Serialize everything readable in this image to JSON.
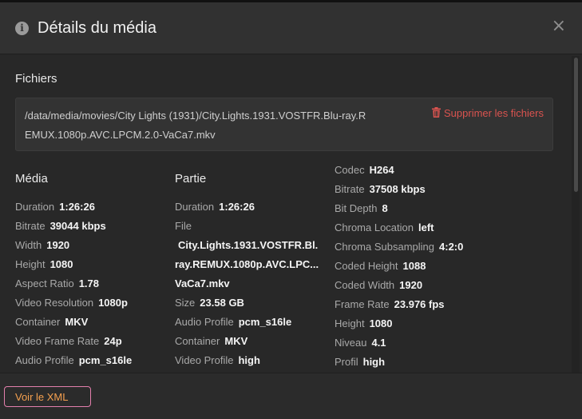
{
  "header": {
    "title": "Détails du média",
    "info_icon": "i",
    "close_icon": "×"
  },
  "files": {
    "section_title": "Fichiers",
    "path": "/data/media/movies/City Lights (1931)/City.Lights.1931.VOSTFR.Blu-ray.REMUX.1080p.AVC.LPCM.2.0-VaCa7.mkv",
    "delete_label": "Supprimer les fichiers",
    "delete_icon": "trash-icon"
  },
  "media": {
    "title": "Média",
    "rows": [
      {
        "key": "Duration",
        "value": "1:26:26"
      },
      {
        "key": "Bitrate",
        "value": "39044 kbps"
      },
      {
        "key": "Width",
        "value": "1920"
      },
      {
        "key": "Height",
        "value": "1080"
      },
      {
        "key": "Aspect Ratio",
        "value": "1.78"
      },
      {
        "key": "Video Resolution",
        "value": "1080p"
      },
      {
        "key": "Container",
        "value": "MKV"
      },
      {
        "key": "Video Frame Rate",
        "value": "24p"
      },
      {
        "key": "Audio Profile",
        "value": "pcm_s16le"
      }
    ]
  },
  "part": {
    "title": "Partie",
    "duration_key": "Duration",
    "duration_value": "1:26:26",
    "file_key": "File",
    "file_lines": [
      "City.Lights.1931.VOSTFR.Bl...",
      "ray.REMUX.1080p.AVC.LPC...",
      "VaCa7.mkv"
    ],
    "rows": [
      {
        "key": "Size",
        "value": "23.58 GB"
      },
      {
        "key": "Audio Profile",
        "value": "pcm_s16le"
      },
      {
        "key": "Container",
        "value": "MKV"
      },
      {
        "key": "Video Profile",
        "value": "high"
      }
    ]
  },
  "stream": {
    "rows": [
      {
        "key": "Codec",
        "value": "H264"
      },
      {
        "key": "Bitrate",
        "value": "37508 kbps"
      },
      {
        "key": "Bit Depth",
        "value": "8"
      },
      {
        "key": "Chroma Location",
        "value": "left"
      },
      {
        "key": "Chroma Subsampling",
        "value": "4:2:0"
      },
      {
        "key": "Coded Height",
        "value": "1088"
      },
      {
        "key": "Coded Width",
        "value": "1920"
      },
      {
        "key": "Frame Rate",
        "value": "23.976 fps"
      },
      {
        "key": "Height",
        "value": "1080"
      },
      {
        "key": "Niveau",
        "value": "4.1"
      },
      {
        "key": "Profil",
        "value": "high"
      }
    ]
  },
  "footer": {
    "xml_button": "Voir le XML"
  }
}
